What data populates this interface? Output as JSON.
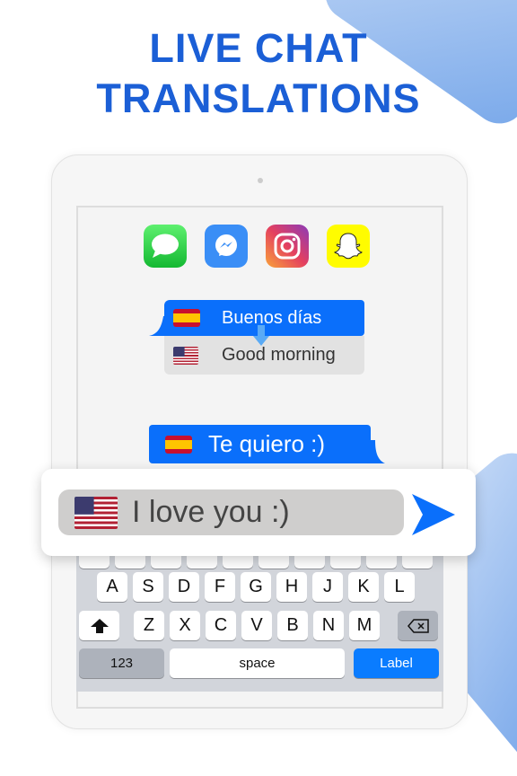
{
  "headline": {
    "line1": "LIVE CHAT",
    "line2": "TRANSLATIONS"
  },
  "apps": [
    {
      "name": "messages-icon",
      "color": "#2ec94a"
    },
    {
      "name": "messenger-icon",
      "color": "#3a8ef6"
    },
    {
      "name": "instagram-icon",
      "color": "#d6336c"
    },
    {
      "name": "snapchat-icon",
      "color": "#fffc00"
    }
  ],
  "chat": {
    "msg1_original": "Buenos días",
    "msg1_translation": "Good morning",
    "msg2": "Te quiero :)"
  },
  "input": {
    "value": "I love you :)"
  },
  "keyboard": {
    "row2": [
      "A",
      "S",
      "D",
      "F",
      "G",
      "H",
      "J",
      "K",
      "L"
    ],
    "row3": [
      "Z",
      "X",
      "C",
      "V",
      "B",
      "N",
      "M"
    ],
    "numbers": "123",
    "space": "space",
    "action": "Label"
  },
  "colors": {
    "accent": "#0a6ffb",
    "title": "#1b5fd6"
  }
}
